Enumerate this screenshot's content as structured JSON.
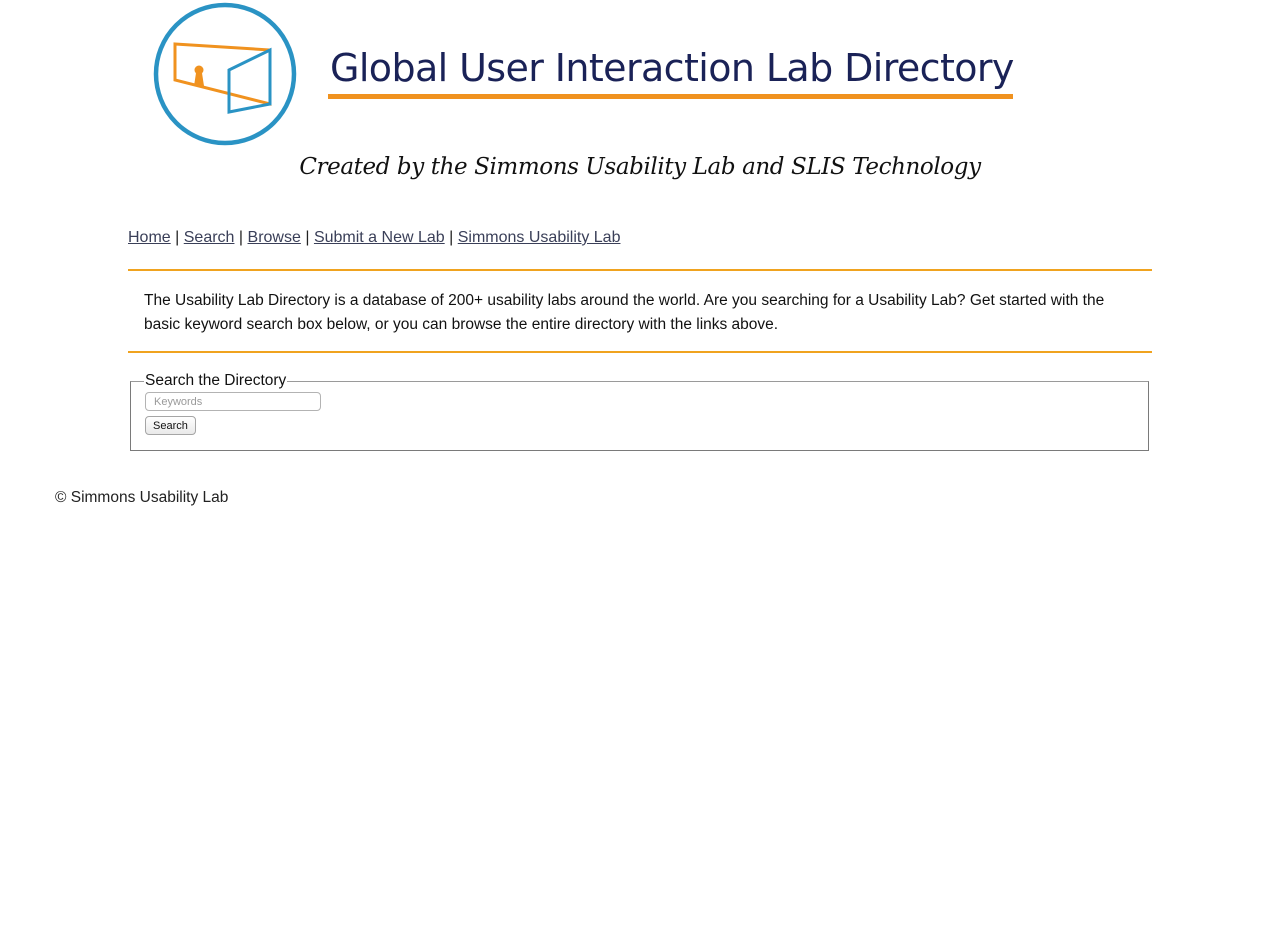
{
  "header": {
    "title": "Global User Interaction Lab Directory",
    "tagline": "Created by the Simmons Usability Lab and SLIS Technology"
  },
  "nav": {
    "items": [
      "Home",
      "Search",
      "Browse",
      "Submit a New Lab",
      "Simmons Usability Lab"
    ],
    "separator": "|"
  },
  "intro": {
    "text": "The Usability Lab Directory is a database of 200+ usability labs around the world. Are you searching for a Usability Lab? Get started with the basic keyword search box below, or you can browse the entire directory with the links above."
  },
  "search": {
    "legend": "Search the Directory",
    "placeholder": "Keywords",
    "value": "",
    "button_label": "Search"
  },
  "footer": {
    "text": "© Simmons Usability Lab"
  },
  "colors": {
    "accent_orange": "#f0921f",
    "logo_blue": "#2a93c4",
    "title_navy": "#1a2257",
    "rule_orange": "#f0a31f",
    "link": "#3a3f58"
  }
}
